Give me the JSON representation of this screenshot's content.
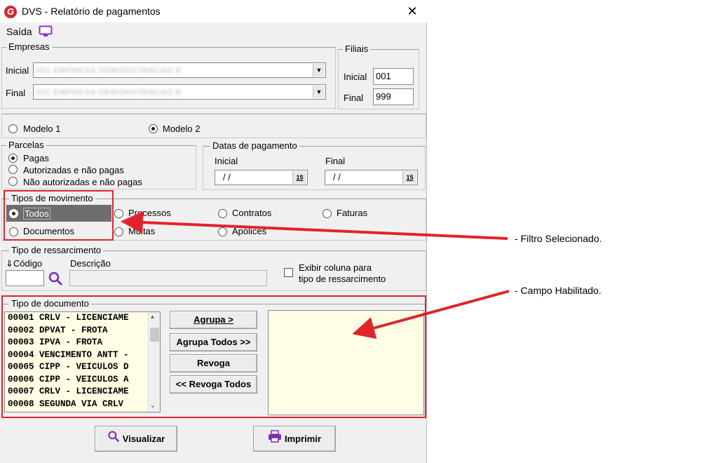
{
  "window": {
    "title": "DVS - Relatório de pagamentos",
    "close_glyph": "✕",
    "logo_letter": "G"
  },
  "menu": {
    "exit_label": "Saída"
  },
  "empresas": {
    "legend": "Empresas",
    "inicial_label": "Inicial",
    "final_label": "Final",
    "inicial_value": "001 EMPRESA DEMONSTRACAO E",
    "final_value": "001 EMPRESA DEMONSTRACAO E"
  },
  "filiais": {
    "legend": "Filiais",
    "inicial_label": "Inicial",
    "final_label": "Final",
    "inicial_value": "001",
    "final_value": "999"
  },
  "modelo": {
    "option1": "Modelo 1",
    "option2": "Modelo 2",
    "selected": "Modelo 2"
  },
  "parcelas": {
    "legend": "Parcelas",
    "options": [
      "Pagas",
      "Autorizadas e não pagas",
      "Não autorizadas e não pagas"
    ],
    "selected": "Pagas"
  },
  "datas": {
    "legend": "Datas de pagamento",
    "inicial_label": "Inicial",
    "final_label": "Final",
    "inicial_value": "/ /",
    "final_value": "/ /",
    "calendar_glyph": "15"
  },
  "tipos_movimento": {
    "legend": "Tipos de movimento",
    "options": [
      "Todos",
      "Processos",
      "Contratos",
      "Faturas",
      "Documentos",
      "Multas",
      "Apólices"
    ],
    "selected": "Todos"
  },
  "ressarcimento": {
    "legend": "Tipo de ressarcimento",
    "codigo_label": "⇓Código",
    "descricao_label": "Descrição",
    "exibir_line1": "Exibir coluna para",
    "exibir_line2": "tipo de ressarcimento"
  },
  "tipo_documento": {
    "legend": "Tipo de documento",
    "items": [
      "00001 CRLV - LICENCIAME",
      "00002 DPVAT - FROTA",
      "00003 IPVA - FROTA",
      "00004 VENCIMENTO ANTT -",
      "00005 CIPP - VEICULOS D",
      "00006 CIPP - VEICULOS A",
      "00007 CRLV - LICENCIAME",
      "00008 SEGUNDA VIA CRLV"
    ],
    "buttons": {
      "agrupa": "Agrupa >",
      "agrupa_todos": "Agrupa Todos >>",
      "revoga": "Revoga",
      "revoga_todos": "<< Revoga Todos"
    }
  },
  "footer": {
    "visualizar": "Visualizar",
    "imprimir": "Imprimir"
  },
  "annotations": {
    "filtro": "- Filtro Selecionado.",
    "campo": "- Campo Habilitado."
  },
  "colors": {
    "highlight_red": "#e0242c",
    "list_bg": "#fffde5",
    "selected_bg": "#6d6d6d",
    "accent_purple": "#7b2fb5"
  }
}
